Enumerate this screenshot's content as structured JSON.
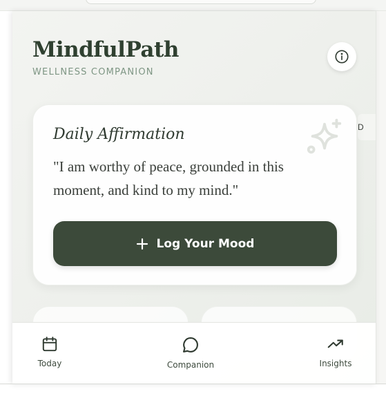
{
  "app": {
    "brand": "MindfulPath",
    "tagline": "WELLNESS COMPANION"
  },
  "icons": {
    "info": "info-icon",
    "sparkle": "sparkle-icon",
    "plus": "plus-icon",
    "today": "calendar-icon",
    "companion": "chat-bubble-icon",
    "insights": "trend-up-icon"
  },
  "peek": {
    "label": "D"
  },
  "affirmation": {
    "title": "Daily Affirmation",
    "text": "\"I am worthy of peace, grounded in this moment, and kind to my mind.\""
  },
  "actions": {
    "log_mood": "Log Your Mood"
  },
  "nav": {
    "items": [
      {
        "label": "Today"
      },
      {
        "label": "Companion"
      },
      {
        "label": "Insights"
      }
    ]
  },
  "colors": {
    "accent": "#3c4a3a",
    "brand_text": "#2f4030",
    "tagline": "#7e9684"
  }
}
